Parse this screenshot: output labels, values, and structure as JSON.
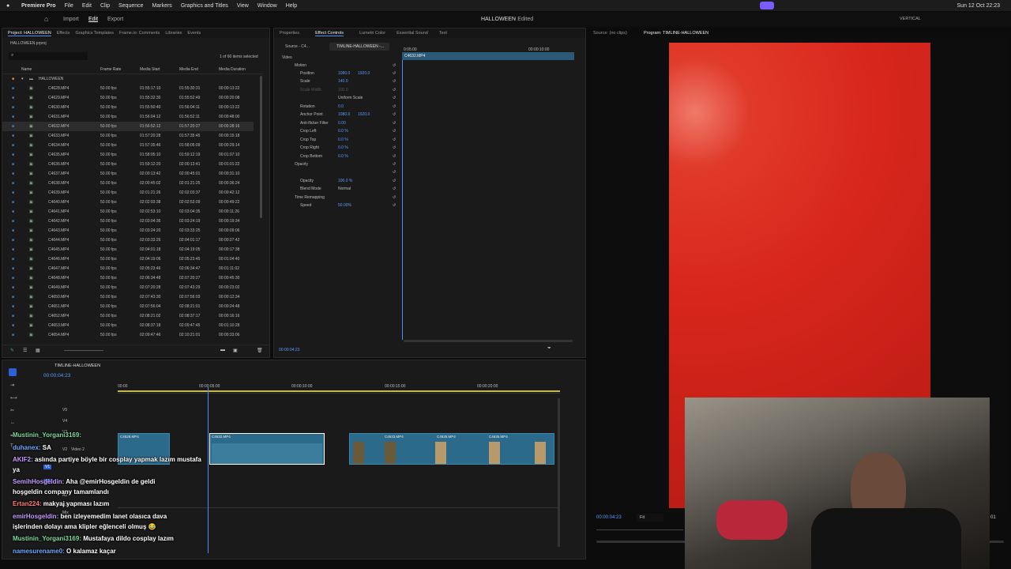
{
  "menubar": {
    "app": "Premiere Pro",
    "items": [
      "File",
      "Edit",
      "Clip",
      "Sequence",
      "Markers",
      "Graphics and Titles",
      "View",
      "Window",
      "Help"
    ],
    "clock": "Sun 12 Oct  22:23"
  },
  "workspace": {
    "tabs": [
      "Import",
      "Edit",
      "Export"
    ],
    "title": "HALLOWEEN",
    "status": "- Edited",
    "layout": "VERTICAL"
  },
  "project": {
    "tabs": [
      "Project: HALLOWEEN",
      "Effects",
      "Graphics Templates",
      "Frame.io: Comments",
      "Libraries",
      "Events"
    ],
    "file": "HALLOWEEN.prproj",
    "selection": "1 of 60 items selected",
    "columns": [
      "Name",
      "Frame Rate",
      "Media Start",
      "Media End",
      "Media Duration"
    ],
    "folder": "HALLOWEEN",
    "rows": [
      [
        "C4628.MP4",
        "50.00 fps",
        "01:55:17:10",
        "01:55:30:31",
        "00:00:13:22"
      ],
      [
        "C4629.MP4",
        "50.00 fps",
        "01:55:32:30",
        "01:55:52:49",
        "00:00:20:08"
      ],
      [
        "C4630.MP4",
        "50.00 fps",
        "01:55:50:40",
        "01:56:04:11",
        "00:00:13:22"
      ],
      [
        "C4631.MP4",
        "50.00 fps",
        "01:56:04:12",
        "01:56:52:11",
        "00:00:48:00"
      ],
      [
        "C4632.MP4",
        "50.00 fps",
        "01:56:52:12",
        "01:57:20:27",
        "00:00:28:16"
      ],
      [
        "C4633.MP4",
        "50.00 fps",
        "01:57:20:28",
        "01:57:35:45",
        "00:00:15:18"
      ],
      [
        "C4634.MP4",
        "50.00 fps",
        "01:57:35:46",
        "01:58:05:09",
        "00:00:29:14"
      ],
      [
        "C4635.MP4",
        "50.00 fps",
        "01:58:05:10",
        "01:59:12:19",
        "00:01:07:10"
      ],
      [
        "C4636.MP4",
        "50.00 fps",
        "01:59:12:20",
        "02:00:13:41",
        "00:01:01:22"
      ],
      [
        "C4637.MP4",
        "50.00 fps",
        "02:00:13:42",
        "02:00:45:01",
        "00:00:31:10"
      ],
      [
        "C4638.MP4",
        "50.00 fps",
        "02:00:45:02",
        "02:01:21:25",
        "00:00:36:24"
      ],
      [
        "C4639.MP4",
        "50.00 fps",
        "02:01:21:26",
        "02:02:03:37",
        "00:00:42:12"
      ],
      [
        "C4640.MP4",
        "50.00 fps",
        "02:02:03:38",
        "02:02:53:09",
        "00:00:49:22"
      ],
      [
        "C4641.MP4",
        "50.00 fps",
        "02:02:53:10",
        "02:03:04:35",
        "00:00:11:26"
      ],
      [
        "C4642.MP4",
        "50.00 fps",
        "02:03:04:36",
        "02:03:24:19",
        "00:00:19:34"
      ],
      [
        "C4643.MP4",
        "50.00 fps",
        "02:03:24:20",
        "02:03:33:25",
        "00:00:09:06"
      ],
      [
        "C4644.MP4",
        "50.00 fps",
        "02:03:33:26",
        "02:04:01:17",
        "00:00:27:42"
      ],
      [
        "C4645.MP4",
        "50.00 fps",
        "02:04:01:18",
        "02:04:19:05",
        "00:00:17:38"
      ],
      [
        "C4646.MP4",
        "50.00 fps",
        "02:04:19:06",
        "02:05:23:45",
        "00:01:04:40"
      ],
      [
        "C4647.MP4",
        "50.00 fps",
        "02:05:23:46",
        "02:06:34:47",
        "00:01:11:02"
      ],
      [
        "C4648.MP4",
        "50.00 fps",
        "02:06:34:48",
        "02:07:20:27",
        "00:00:45:30"
      ],
      [
        "C4649.MP4",
        "50.00 fps",
        "02:07:20:28",
        "02:07:43:29",
        "00:00:23:02"
      ],
      [
        "C4650.MP4",
        "50.00 fps",
        "02:07:43:30",
        "02:07:56:03",
        "00:00:12:34"
      ],
      [
        "C4651.MP4",
        "50.00 fps",
        "02:07:56:04",
        "02:08:21:01",
        "00:00:24:48"
      ],
      [
        "C4652.MP4",
        "50.00 fps",
        "02:08:21:02",
        "02:08:37:17",
        "00:00:16:16"
      ],
      [
        "C4653.MP4",
        "50.00 fps",
        "02:08:37:18",
        "02:09:47:45",
        "00:01:10:28"
      ],
      [
        "C4654.MP4",
        "50.00 fps",
        "02:09:47:46",
        "02:10:21:01",
        "00:00:33:06"
      ]
    ]
  },
  "effects": {
    "tabs": [
      "Properties",
      "Effect Controls",
      "Lumetri Color",
      "Essential Sound",
      "Text"
    ],
    "source": "Source - C4...",
    "seq": "TIMLINE-HALLOWEEN -...",
    "ruler": [
      "0:05:00",
      "00:00:10:00"
    ],
    "clipname": "C4632.MP4",
    "section": "Video",
    "rows": [
      {
        "label": "Motion",
        "v1": "",
        "v2": ""
      },
      {
        "label": "Position",
        "v1": "1080.0",
        "v2": "1920.0"
      },
      {
        "label": "Scale",
        "v1": "140.0",
        "v2": ""
      },
      {
        "label": "Scale Width",
        "v1": "100.0",
        "v2": ""
      },
      {
        "label": "",
        "v1": "Uniform Scale",
        "v2": ""
      },
      {
        "label": "Rotation",
        "v1": "0.0",
        "v2": ""
      },
      {
        "label": "Anchor Point",
        "v1": "1080.0",
        "v2": "1920.0"
      },
      {
        "label": "Anti-flicker Filter",
        "v1": "0.00",
        "v2": ""
      },
      {
        "label": "Crop Left",
        "v1": "0.0 %",
        "v2": ""
      },
      {
        "label": "Crop Top",
        "v1": "0.0 %",
        "v2": ""
      },
      {
        "label": "Crop Right",
        "v1": "0.0 %",
        "v2": ""
      },
      {
        "label": "Crop Bottom",
        "v1": "0.0 %",
        "v2": ""
      },
      {
        "label": "Opacity",
        "v1": "",
        "v2": ""
      },
      {
        "label": "",
        "v1": "",
        "v2": ""
      },
      {
        "label": "Opacity",
        "v1": "100.0 %",
        "v2": ""
      },
      {
        "label": "Blend Mode",
        "v1": "Normal",
        "v2": ""
      },
      {
        "label": "Time Remapping",
        "v1": "",
        "v2": ""
      },
      {
        "label": "Speed",
        "v1": "50.00%",
        "v2": ""
      }
    ],
    "timecode": "00:00:04:23"
  },
  "source_monitor": {
    "label": "Source: (no clips)"
  },
  "program": {
    "label": "Program: TIMLINE-HALLOWEEN",
    "timecode": "00:00:04:23",
    "fit": "Fit",
    "end": "01"
  },
  "timeline": {
    "name": "TIMLINE-HALLOWEEN",
    "timecode": "00:00:04:23",
    "ruler": [
      "00:00",
      "00:00:05:00",
      "00:00:10:00",
      "00:00:15:00",
      "00:00:20:00"
    ],
    "tracks": [
      "V5",
      "V4",
      "V3",
      "V2",
      "V1",
      "A1",
      "A2",
      "A3",
      "Mix"
    ],
    "clips": [
      "C4628.MP4",
      "C4632.MP4",
      "C4633.MP4",
      "C4635.MP4",
      "C4635.MP4"
    ],
    "track_label": "Video 2"
  },
  "chat": [
    {
      "user": "Mustinin_Yorgani3169:",
      "msg": ""
    },
    {
      "user": "duhanex:",
      "msg": "SA"
    },
    {
      "user": "AKIF2:",
      "msg": "aslında partiye böyle bir cosplay yapmak lazım mustafa"
    },
    {
      "user": "",
      "msg": "ya"
    },
    {
      "user": "SemihHosgeldin:",
      "msg": "Aha @emirHosgeldin de geldi"
    },
    {
      "user": "",
      "msg": "hoşgeldin company tamamlandı"
    },
    {
      "user": "Ertan224:",
      "msg": "makyaj yapması lazım"
    },
    {
      "user": "emirHosgeldin:",
      "msg": "ben izleyemedim lanet olasıca dava"
    },
    {
      "user": "",
      "msg": "işlerinden dolayı ama klipler eğlenceli olmuş 😂"
    },
    {
      "user": "Mustinin_Yorgani3169:",
      "msg": "Mustafaya dildo cosplay lazım"
    },
    {
      "user": "namesurename0:",
      "msg": "O kalamaz kaçar"
    }
  ],
  "colors": {
    "accent": "#4a8cff",
    "clip": "#2b6a8a",
    "program_bg": "#d8261c"
  }
}
